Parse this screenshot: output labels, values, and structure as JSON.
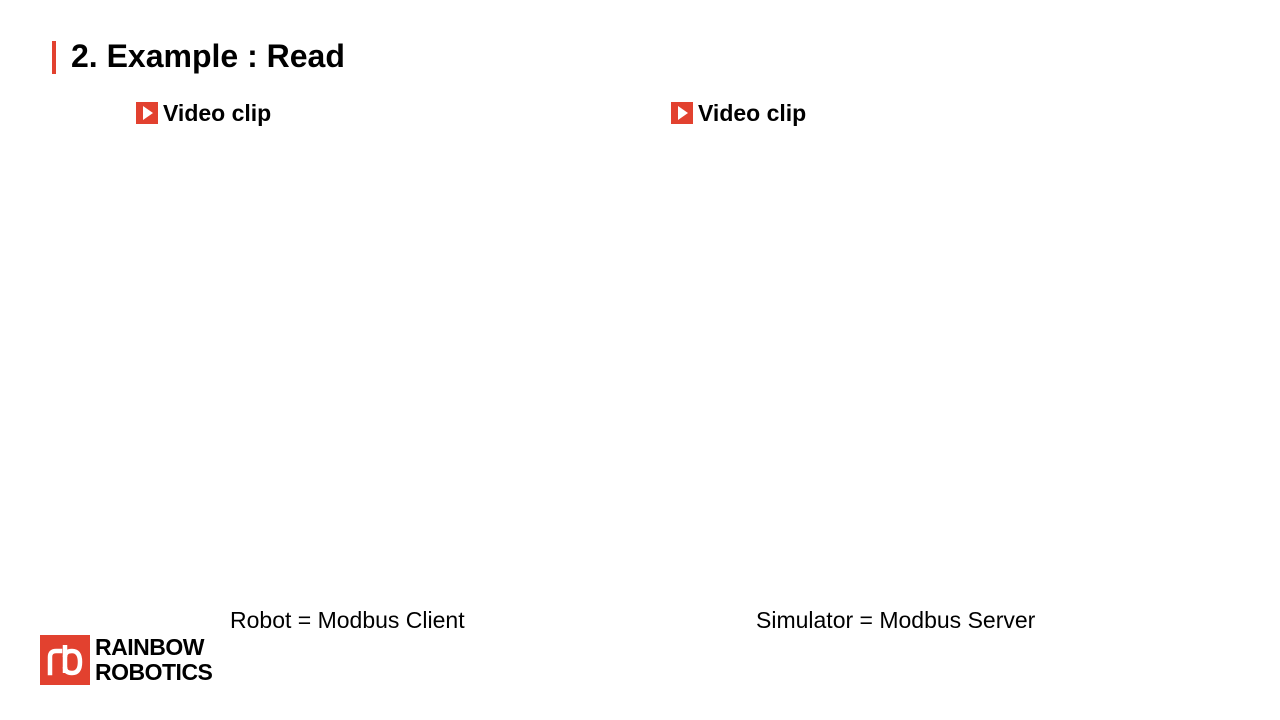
{
  "slide": {
    "title": "2. Example : Read",
    "accent_color": "#e2412f"
  },
  "clips": {
    "left": {
      "label": "Video clip",
      "icon": "play-icon"
    },
    "right": {
      "label": "Video clip",
      "icon": "play-icon"
    }
  },
  "captions": {
    "left": "Robot = Modbus Client",
    "right": "Simulator = Modbus Server"
  },
  "logo": {
    "line1": "RAINBOW",
    "line2": "ROBOTICS",
    "color": "#e2412f"
  }
}
